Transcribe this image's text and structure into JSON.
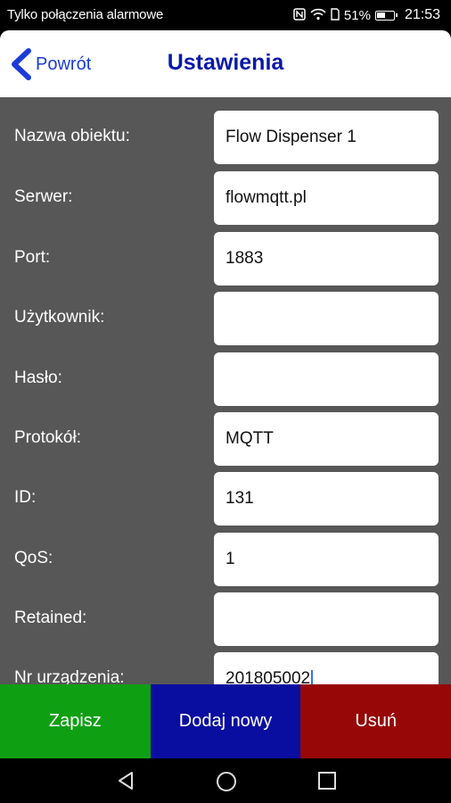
{
  "status_bar": {
    "carrier": "Tylko połączenia alarmowe",
    "icons": [
      "nfc-icon",
      "wifi-icon",
      "sim-icon",
      "battery-icon"
    ],
    "battery": "51%",
    "time": "21:53"
  },
  "header": {
    "back_label": "Powrót",
    "title": "Ustawienia"
  },
  "form": {
    "fields": [
      {
        "label": "Nazwa obiektu:",
        "value": "Flow Dispenser 1"
      },
      {
        "label": "Serwer:",
        "value": "flowmqtt.pl"
      },
      {
        "label": "Port:",
        "value": "1883"
      },
      {
        "label": "Użytkownik:",
        "value": ""
      },
      {
        "label": "Hasło:",
        "value": ""
      },
      {
        "label": "Protokół:",
        "value": "MQTT"
      },
      {
        "label": "ID:",
        "value": "131"
      },
      {
        "label": "QoS:",
        "value": "1"
      },
      {
        "label": "Retained:",
        "value": ""
      },
      {
        "label": "Nr urządzenia:",
        "value": "201805002"
      }
    ]
  },
  "actions": {
    "save": "Zapisz",
    "add": "Dodaj nowy",
    "delete": "Usuń"
  },
  "colors": {
    "title": "#0b19a8",
    "back": "#1a3bd6",
    "form_bg": "#575757",
    "save": "#0f9f13",
    "add": "#0a0ea0",
    "delete": "#970707"
  }
}
